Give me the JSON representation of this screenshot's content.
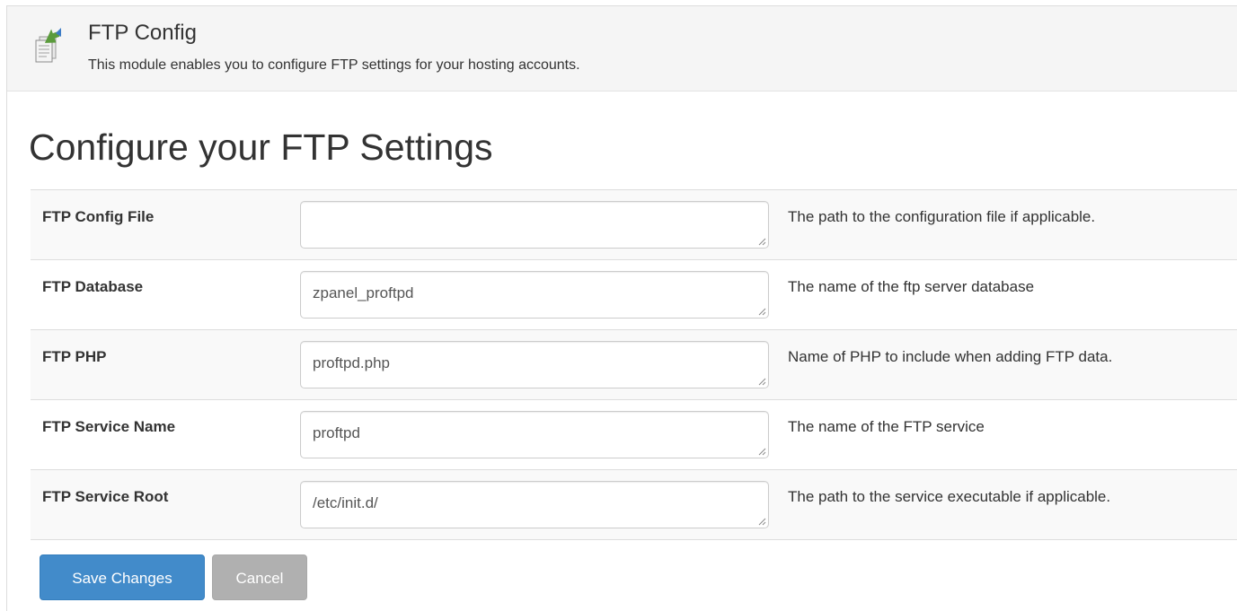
{
  "module": {
    "title": "FTP Config",
    "description": "This module enables you to configure FTP settings for your hosting accounts.",
    "icon": "ftp-config-icon"
  },
  "page": {
    "heading": "Configure your FTP Settings"
  },
  "settings": [
    {
      "label": "FTP Config File",
      "value": "",
      "help": "The path to the configuration file if applicable."
    },
    {
      "label": "FTP Database",
      "value": "zpanel_proftpd",
      "help": "The name of the ftp server database"
    },
    {
      "label": "FTP PHP",
      "value": "proftpd.php",
      "help": "Name of PHP to include when adding FTP data."
    },
    {
      "label": "FTP Service Name",
      "value": "proftpd",
      "help": "The name of the FTP service"
    },
    {
      "label": "FTP Service Root",
      "value": "/etc/init.d/",
      "help": "The path to the service executable if applicable."
    }
  ],
  "actions": {
    "save_label": "Save Changes",
    "cancel_label": "Cancel"
  },
  "colors": {
    "primary": "#428bca",
    "cancel": "#b0b0b0",
    "header_bg": "#f5f5f5",
    "stripe_bg": "#f9f9f9"
  }
}
